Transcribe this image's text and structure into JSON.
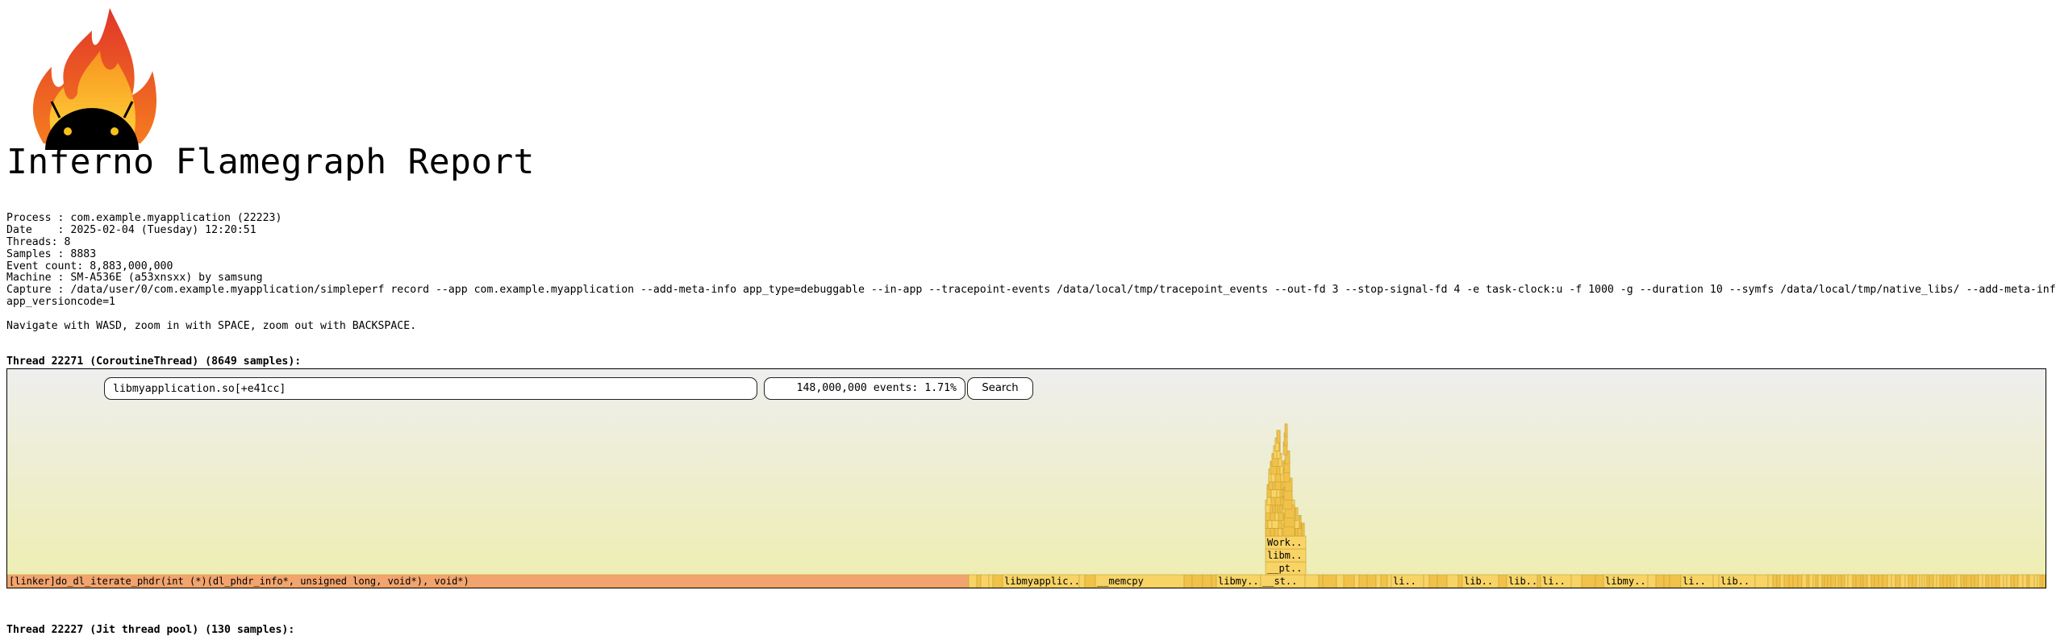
{
  "report": {
    "title": "Inferno Flamegraph Report",
    "meta_lines": [
      "Process : com.example.myapplication (22223)",
      "Date    : 2025-02-04 (Tuesday) 12:20:51",
      "Threads: 8",
      "Samples : 8883",
      "Event count: 8,883,000,000",
      "Machine : SM-A536E (a53xnsxx) by samsung",
      "Capture : /data/user/0/com.example.myapplication/simpleperf record --app com.example.myapplication --add-meta-info app_type=debuggable --in-app --tracepoint-events /data/local/tmp/tracepoint_events --out-fd 3 --stop-signal-fd 4 -e task-clock:u -f 1000 -g --duration 10 --symfs /data/local/tmp/native_libs/ --add-meta-info",
      "app_versioncode=1"
    ],
    "navigation_hint": "Navigate with WASD, zoom in with SPACE, zoom out with BACKSPACE."
  },
  "threads": [
    {
      "title": "Thread 22271 (CoroutineThread) (8649 samples):",
      "search_value": "libmyapplication.so[+e41cc]",
      "events_readout": "148,000,000 events: 1.71%",
      "search_button_label": "Search"
    },
    {
      "title": "Thread 22227 (Jit thread pool) (130 samples):"
    }
  ],
  "colors": {
    "root_frame": "#f2a46e",
    "frame": "#f8d466",
    "frame_alt": "#f0c24a",
    "frame_stroke": "#c9a030",
    "bg_top": "#eeeeee",
    "bg_bottom": "#eeeeb0"
  },
  "icons": [
    "inferno-flame-android-logo"
  ],
  "flamegraph": {
    "root_label": "[linker]do_dl_iterate_phdr(int (*)(dl_phdr_info*, unsigned long, void*), void*)",
    "bottom_labels": [
      "libmyapplic..",
      "__memcpy",
      "libmy..",
      "__st..",
      "li..",
      "lib..",
      "lib..",
      "li..",
      "libmy..",
      "li..",
      "lib.."
    ],
    "stack_labels": [
      "Work..",
      "libm..",
      "__pt.."
    ]
  }
}
